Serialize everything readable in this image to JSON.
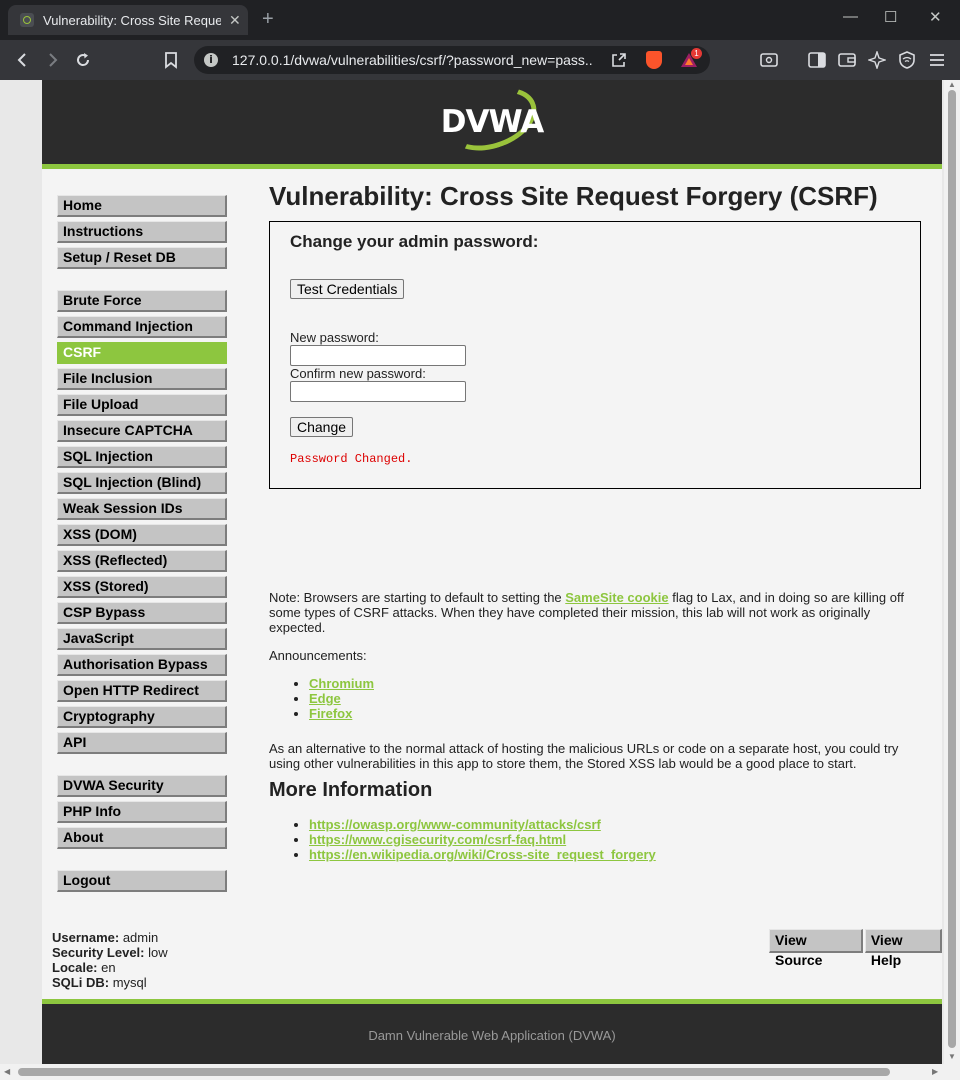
{
  "browser": {
    "tab_title": "Vulnerability: Cross Site Request",
    "url": "127.0.0.1/dvwa/vulnerabilities/csrf/?password_new=pass...",
    "rewards_badge": "1",
    "icons": [
      "back-icon",
      "forward-icon",
      "reload-icon",
      "bookmark-icon",
      "site-info-icon",
      "share-icon",
      "brave-shields-icon",
      "brave-rewards-icon",
      "reading-mode-icon",
      "sidebar-icon",
      "wallet-icon",
      "leo-ai-icon",
      "vpn-icon",
      "menu-icon"
    ]
  },
  "header": {
    "logo_text": "DVWA"
  },
  "menu": {
    "group1": [
      {
        "label": "Home"
      },
      {
        "label": "Instructions"
      },
      {
        "label": "Setup / Reset DB"
      }
    ],
    "group2": [
      {
        "label": "Brute Force"
      },
      {
        "label": "Command Injection"
      },
      {
        "label": "CSRF",
        "selected": true
      },
      {
        "label": "File Inclusion"
      },
      {
        "label": "File Upload"
      },
      {
        "label": "Insecure CAPTCHA"
      },
      {
        "label": "SQL Injection"
      },
      {
        "label": "SQL Injection (Blind)"
      },
      {
        "label": "Weak Session IDs"
      },
      {
        "label": "XSS (DOM)"
      },
      {
        "label": "XSS (Reflected)"
      },
      {
        "label": "XSS (Stored)"
      },
      {
        "label": "CSP Bypass"
      },
      {
        "label": "JavaScript"
      },
      {
        "label": "Authorisation Bypass"
      },
      {
        "label": "Open HTTP Redirect"
      },
      {
        "label": "Cryptography"
      },
      {
        "label": "API"
      }
    ],
    "group3": [
      {
        "label": "DVWA Security"
      },
      {
        "label": "PHP Info"
      },
      {
        "label": "About"
      }
    ],
    "group4": [
      {
        "label": "Logout"
      }
    ]
  },
  "main": {
    "title": "Vulnerability: Cross Site Request Forgery (CSRF)",
    "form": {
      "title": "Change your admin password:",
      "test_button": "Test Credentials",
      "new_password_label": "New password:",
      "new_password_value": "",
      "confirm_label": "Confirm new password:",
      "confirm_value": "",
      "change_button": "Change",
      "message": "Password Changed."
    },
    "note_prefix": "Note: Browsers are starting to default to setting the ",
    "note_link": "SameSite cookie",
    "note_suffix": " flag to Lax, and in doing so are killing off some types of CSRF attacks. When they have completed their mission, this lab will not work as originally expected.",
    "announcements_label": "Announcements:",
    "announcements": [
      "Chromium",
      "Edge",
      "Firefox"
    ],
    "alternative_text": "As an alternative to the normal attack of hosting the malicious URLs or code on a separate host, you could try using other vulnerabilities in this app to store them, the Stored XSS lab would be a good place to start.",
    "more_info_title": "More Information",
    "more_info_links": [
      "https://owasp.org/www-community/attacks/csrf",
      "https://www.cgisecurity.com/csrf-faq.html",
      "https://en.wikipedia.org/wiki/Cross-site_request_forgery"
    ]
  },
  "user_info": {
    "username_label": "Username:",
    "username": "admin",
    "security_label": "Security Level:",
    "security": "low",
    "locale_label": "Locale:",
    "locale": "en",
    "sqli_label": "SQLi DB:",
    "sqli": "mysql"
  },
  "buttons": {
    "view_source": "View Source",
    "view_help": "View Help"
  },
  "footer": {
    "text": "Damn Vulnerable Web Application (DVWA)"
  },
  "colors": {
    "accent": "#8dc63f",
    "header_bg": "#2c2c2c",
    "error": "#dd0000"
  }
}
